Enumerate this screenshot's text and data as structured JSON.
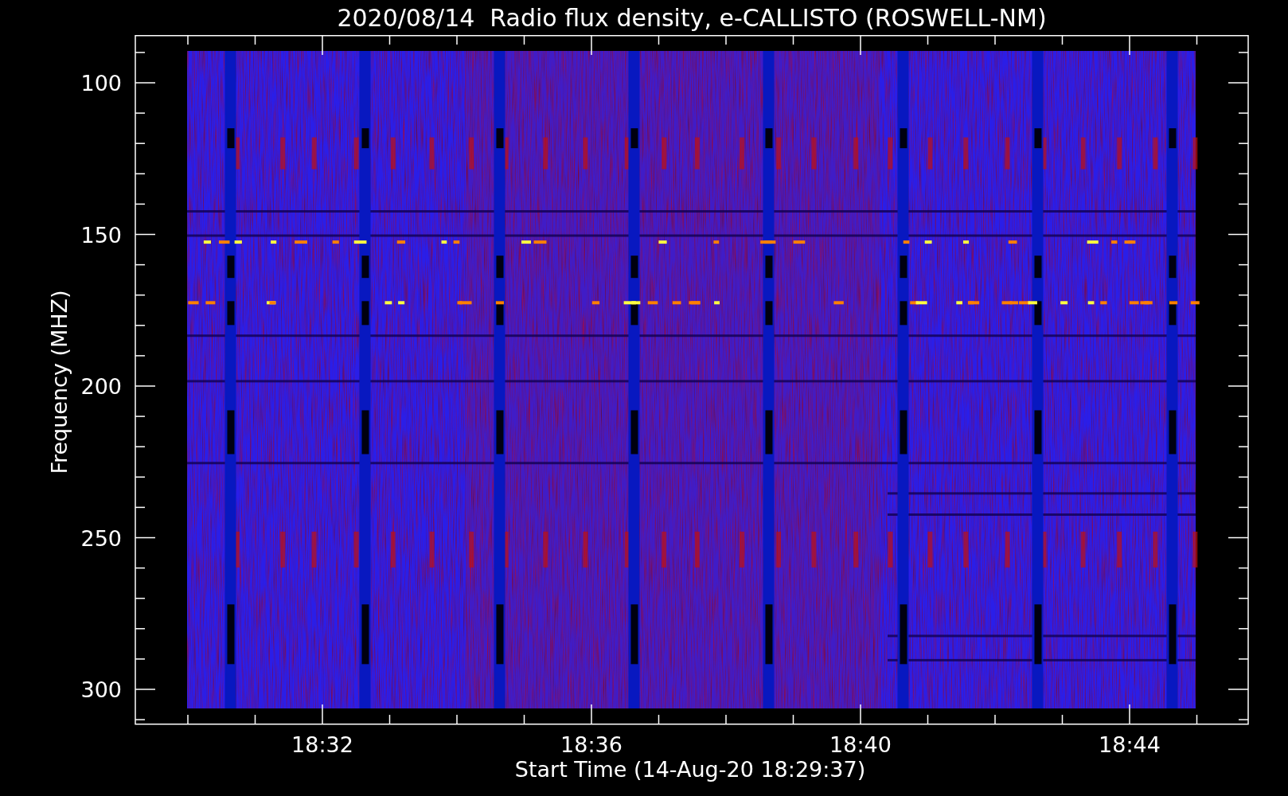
{
  "title": "2020/08/14  Radio flux density, e-CALLISTO (ROSWELL-NM)",
  "y_axis": {
    "label": "Frequency (MHZ)",
    "ticks": [
      "100",
      "150",
      "200",
      "250",
      "300"
    ]
  },
  "x_axis": {
    "label": "Start Time (14-Aug-20 18:29:37)",
    "ticks": [
      "18:32",
      "18:36",
      "18:40",
      "18:44"
    ]
  }
}
